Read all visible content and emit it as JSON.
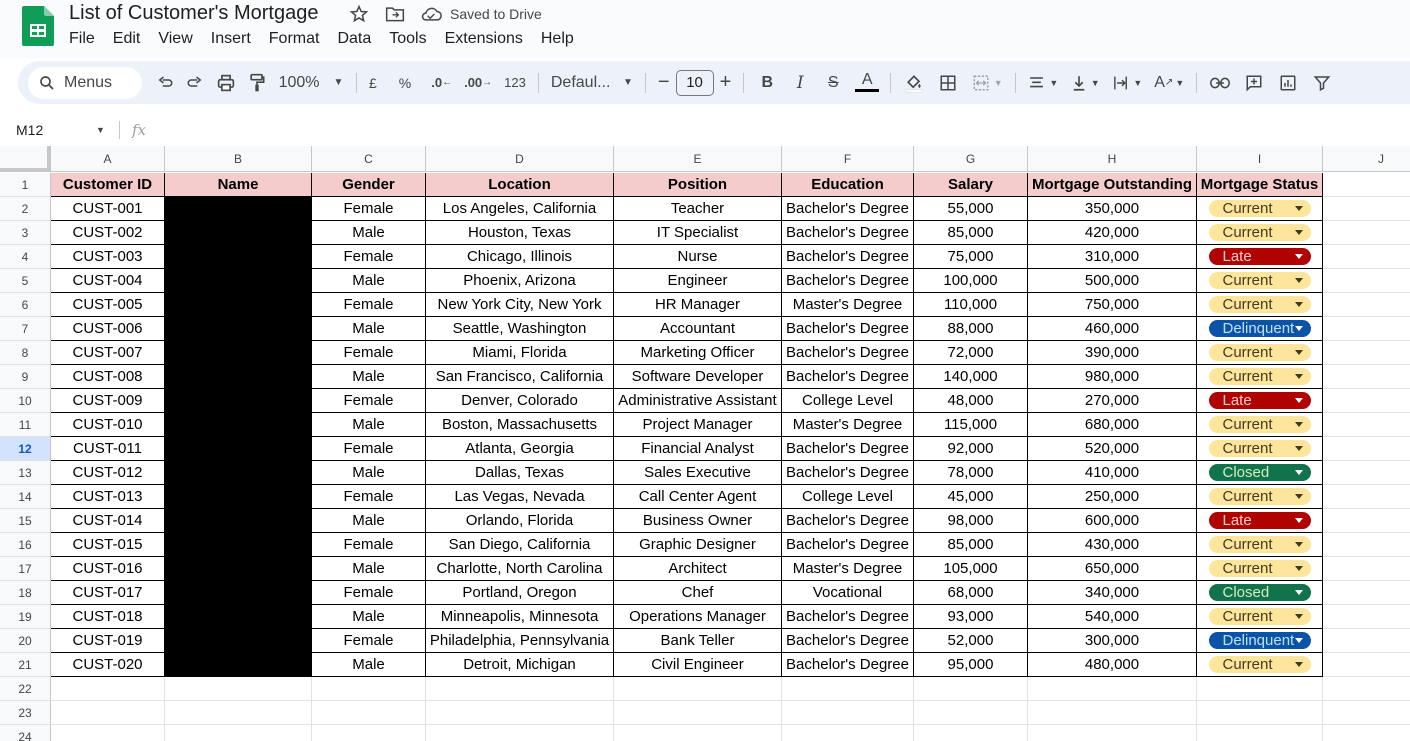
{
  "doc": {
    "title": "List of Customer's Mortgage",
    "saved": "Saved to Drive"
  },
  "menu": [
    "File",
    "Edit",
    "View",
    "Insert",
    "Format",
    "Data",
    "Tools",
    "Extensions",
    "Help"
  ],
  "toolbar": {
    "search": "Menus",
    "zoom": "100%",
    "currency": "£",
    "percent": "%",
    "dec_less": ".0",
    "dec_more": ".00",
    "number_format": "123",
    "font": "Defaul...",
    "font_size": "10"
  },
  "formula_bar": {
    "cell_ref": "M12",
    "fx": "fx"
  },
  "columns": [
    "A",
    "B",
    "C",
    "D",
    "E",
    "F",
    "G",
    "H",
    "I",
    "J"
  ],
  "selected_row": 12,
  "headers": [
    "Customer ID",
    "Name",
    "Gender",
    "Location",
    "Position",
    "Education",
    "Salary",
    "Mortgage Outstanding",
    "Mortgage Status"
  ],
  "status_colors": {
    "Current": {
      "bg": "#fde69c",
      "fg": "#473821",
      "arrow": "#473821"
    },
    "Late": {
      "bg": "#b10202",
      "fg": "#ffcfc9",
      "arrow": "#ffffff"
    },
    "Delinquent": {
      "bg": "#0a53a8",
      "fg": "#bfe1f6",
      "arrow": "#ffffff"
    },
    "Closed": {
      "bg": "#11734b",
      "fg": "#d4edbc",
      "arrow": "#ffffff"
    }
  },
  "rows": [
    {
      "id": "CUST-001",
      "gender": "Female",
      "location": "Los Angeles, California",
      "position": "Teacher",
      "education": "Bachelor's Degree",
      "salary": "55,000",
      "mortgage": "350,000",
      "status": "Current"
    },
    {
      "id": "CUST-002",
      "gender": "Male",
      "location": "Houston, Texas",
      "position": "IT Specialist",
      "education": "Bachelor's Degree",
      "salary": "85,000",
      "mortgage": "420,000",
      "status": "Current"
    },
    {
      "id": "CUST-003",
      "gender": "Female",
      "location": "Chicago, Illinois",
      "position": "Nurse",
      "education": "Bachelor's Degree",
      "salary": "75,000",
      "mortgage": "310,000",
      "status": "Late"
    },
    {
      "id": "CUST-004",
      "gender": "Male",
      "location": "Phoenix, Arizona",
      "position": "Engineer",
      "education": "Bachelor's Degree",
      "salary": "100,000",
      "mortgage": "500,000",
      "status": "Current"
    },
    {
      "id": "CUST-005",
      "gender": "Female",
      "location": "New York City, New York",
      "position": "HR Manager",
      "education": "Master's Degree",
      "salary": "110,000",
      "mortgage": "750,000",
      "status": "Current"
    },
    {
      "id": "CUST-006",
      "gender": "Male",
      "location": "Seattle, Washington",
      "position": "Accountant",
      "education": "Bachelor's Degree",
      "salary": "88,000",
      "mortgage": "460,000",
      "status": "Delinquent"
    },
    {
      "id": "CUST-007",
      "gender": "Female",
      "location": "Miami, Florida",
      "position": "Marketing Officer",
      "education": "Bachelor's Degree",
      "salary": "72,000",
      "mortgage": "390,000",
      "status": "Current"
    },
    {
      "id": "CUST-008",
      "gender": "Male",
      "location": "San Francisco, California",
      "position": "Software Developer",
      "education": "Bachelor's Degree",
      "salary": "140,000",
      "mortgage": "980,000",
      "status": "Current"
    },
    {
      "id": "CUST-009",
      "gender": "Female",
      "location": "Denver, Colorado",
      "position": "Administrative Assistant",
      "education": "College Level",
      "salary": "48,000",
      "mortgage": "270,000",
      "status": "Late"
    },
    {
      "id": "CUST-010",
      "gender": "Male",
      "location": "Boston, Massachusetts",
      "position": "Project Manager",
      "education": "Master's Degree",
      "salary": "115,000",
      "mortgage": "680,000",
      "status": "Current"
    },
    {
      "id": "CUST-011",
      "gender": "Female",
      "location": "Atlanta, Georgia",
      "position": "Financial Analyst",
      "education": "Bachelor's Degree",
      "salary": "92,000",
      "mortgage": "520,000",
      "status": "Current"
    },
    {
      "id": "CUST-012",
      "gender": "Male",
      "location": "Dallas, Texas",
      "position": "Sales Executive",
      "education": "Bachelor's Degree",
      "salary": "78,000",
      "mortgage": "410,000",
      "status": "Closed"
    },
    {
      "id": "CUST-013",
      "gender": "Female",
      "location": "Las Vegas, Nevada",
      "position": "Call Center Agent",
      "education": "College Level",
      "salary": "45,000",
      "mortgage": "250,000",
      "status": "Current"
    },
    {
      "id": "CUST-014",
      "gender": "Male",
      "location": "Orlando, Florida",
      "position": "Business Owner",
      "education": "Bachelor's Degree",
      "salary": "98,000",
      "mortgage": "600,000",
      "status": "Late"
    },
    {
      "id": "CUST-015",
      "gender": "Female",
      "location": "San Diego, California",
      "position": "Graphic Designer",
      "education": "Bachelor's Degree",
      "salary": "85,000",
      "mortgage": "430,000",
      "status": "Current"
    },
    {
      "id": "CUST-016",
      "gender": "Male",
      "location": "Charlotte, North Carolina",
      "position": "Architect",
      "education": "Master's Degree",
      "salary": "105,000",
      "mortgage": "650,000",
      "status": "Current"
    },
    {
      "id": "CUST-017",
      "gender": "Female",
      "location": "Portland, Oregon",
      "position": "Chef",
      "education": "Vocational",
      "salary": "68,000",
      "mortgage": "340,000",
      "status": "Closed"
    },
    {
      "id": "CUST-018",
      "gender": "Male",
      "location": "Minneapolis, Minnesota",
      "position": "Operations Manager",
      "education": "Bachelor's Degree",
      "salary": "93,000",
      "mortgage": "540,000",
      "status": "Current"
    },
    {
      "id": "CUST-019",
      "gender": "Female",
      "location": "Philadelphia, Pennsylvania",
      "position": "Bank Teller",
      "education": "Bachelor's Degree",
      "salary": "52,000",
      "mortgage": "300,000",
      "status": "Delinquent"
    },
    {
      "id": "CUST-020",
      "gender": "Male",
      "location": "Detroit, Michigan",
      "position": "Civil Engineer",
      "education": "Bachelor's Degree",
      "salary": "95,000",
      "mortgage": "480,000",
      "status": "Current"
    }
  ],
  "row_numbers": [
    "1",
    "2",
    "3",
    "4",
    "5",
    "6",
    "7",
    "8",
    "9",
    "10",
    "11",
    "12",
    "13",
    "14",
    "15",
    "16",
    "17",
    "18",
    "19",
    "20",
    "21",
    "22",
    "23",
    "24"
  ]
}
